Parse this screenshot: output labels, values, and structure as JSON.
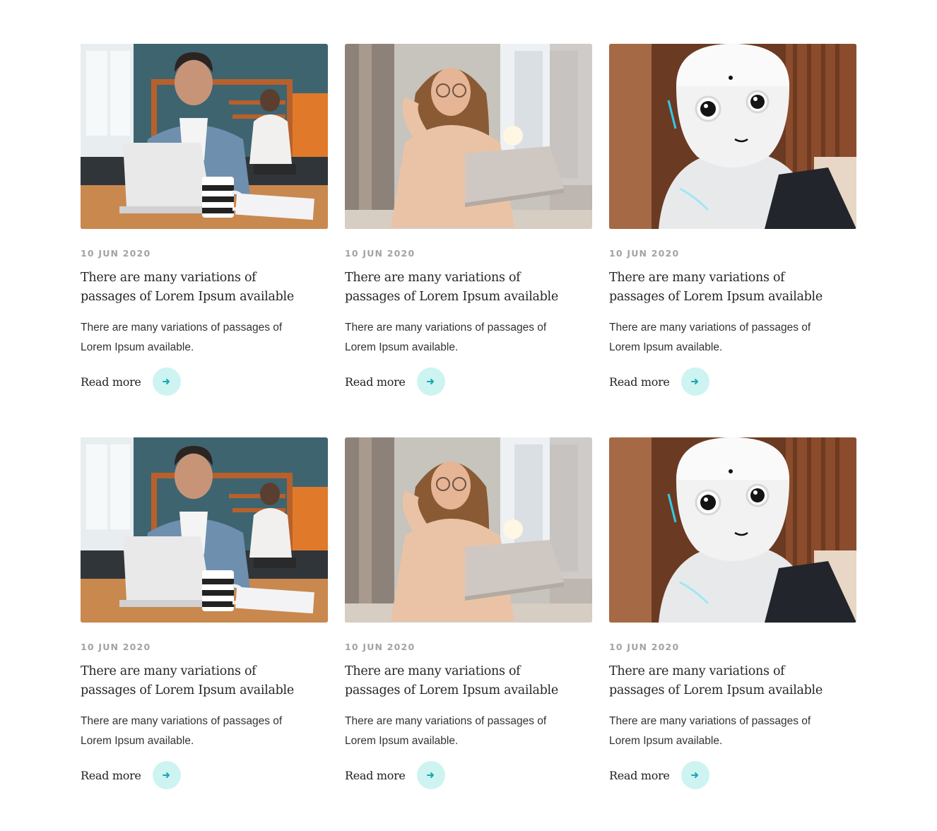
{
  "cards": [
    {
      "image": "man-laptop-photo",
      "date": "10 JUN 2020",
      "title": "There are many variations of passages of Lorem Ipsum available",
      "excerpt": "There are many variations of passages of Lorem Ipsum available.",
      "cta": "Read more",
      "icon": "arrow-right-icon"
    },
    {
      "image": "woman-laptop-photo",
      "date": "10 JUN 2020",
      "title": "There are many variations of passages of Lorem Ipsum available",
      "excerpt": "There are many variations of passages of Lorem Ipsum available.",
      "cta": "Read more",
      "icon": "arrow-right-icon"
    },
    {
      "image": "robot-photo",
      "date": "10 JUN 2020",
      "title": "There are many variations of passages of Lorem Ipsum available",
      "excerpt": "There are many variations of passages of Lorem Ipsum available.",
      "cta": "Read more",
      "icon": "arrow-right-icon"
    },
    {
      "image": "man-laptop-photo",
      "date": "10 JUN 2020",
      "title": "There are many variations of passages of Lorem Ipsum available",
      "excerpt": "There are many variations of passages of Lorem Ipsum available.",
      "cta": "Read more",
      "icon": "arrow-right-icon"
    },
    {
      "image": "woman-laptop-photo",
      "date": "10 JUN 2020",
      "title": "There are many variations of passages of Lorem Ipsum available",
      "excerpt": "There are many variations of passages of Lorem Ipsum available.",
      "cta": "Read more",
      "icon": "arrow-right-icon"
    },
    {
      "image": "robot-photo",
      "date": "10 JUN 2020",
      "title": "There are many variations of passages of Lorem Ipsum available",
      "excerpt": "There are many variations of passages of Lorem Ipsum available.",
      "cta": "Read more",
      "icon": "arrow-right-icon"
    }
  ],
  "colors": {
    "accent_bg": "#cdf4f1",
    "accent_arrow": "#1aa6b5",
    "date": "#a3a3a3"
  }
}
